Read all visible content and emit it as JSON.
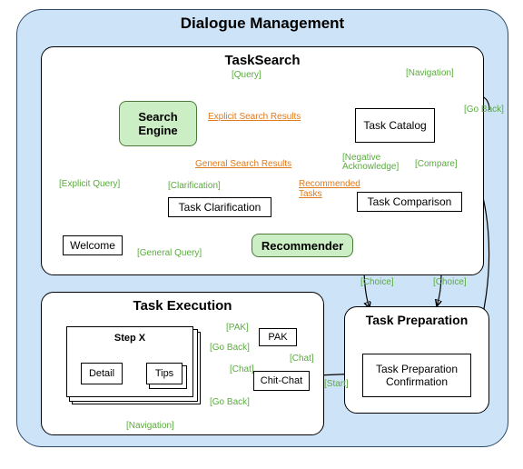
{
  "diagram_title": "Dialogue Management",
  "panels": {
    "tasksearch": {
      "title": "TaskSearch"
    },
    "taskexec": {
      "title": "Task Execution"
    },
    "taskprep": {
      "title": "Task Preparation"
    }
  },
  "nodes": {
    "search_engine": "Search Engine",
    "task_catalog": "Task Catalog",
    "task_clar": "Task Clarification",
    "task_comp": "Task Comparison",
    "welcome": "Welcome",
    "recommender": "Recommender",
    "stepx": "Step X",
    "detail": "Detail",
    "tips": "Tips",
    "pak": "PAK",
    "chitchat": "Chit-Chat",
    "taskprep_conf": "Task Preparation Confirmation"
  },
  "edges": {
    "query": "[Query]",
    "navigation": "[Navigation]",
    "navigation2": "[Navigation]",
    "goback": "[Go Back]",
    "goback2": "[Go Back]",
    "goback3": "[Go Back]",
    "expl_results": "Explicit Search Results",
    "gen_results": "General Search Results",
    "rec_tasks": "Recommended Tasks",
    "clarification": "[Clarification]",
    "neg_ack": "[Negative Acknowledge]",
    "compare": "[Compare]",
    "explicit_query": "[Explicit Query]",
    "general_query": "[General Query]",
    "choice": "[Choice]",
    "choice2": "[Choice]",
    "start": "[Start]",
    "chat": "[Chat]",
    "chat2": "[Chat]",
    "pak": "[PAK]"
  }
}
